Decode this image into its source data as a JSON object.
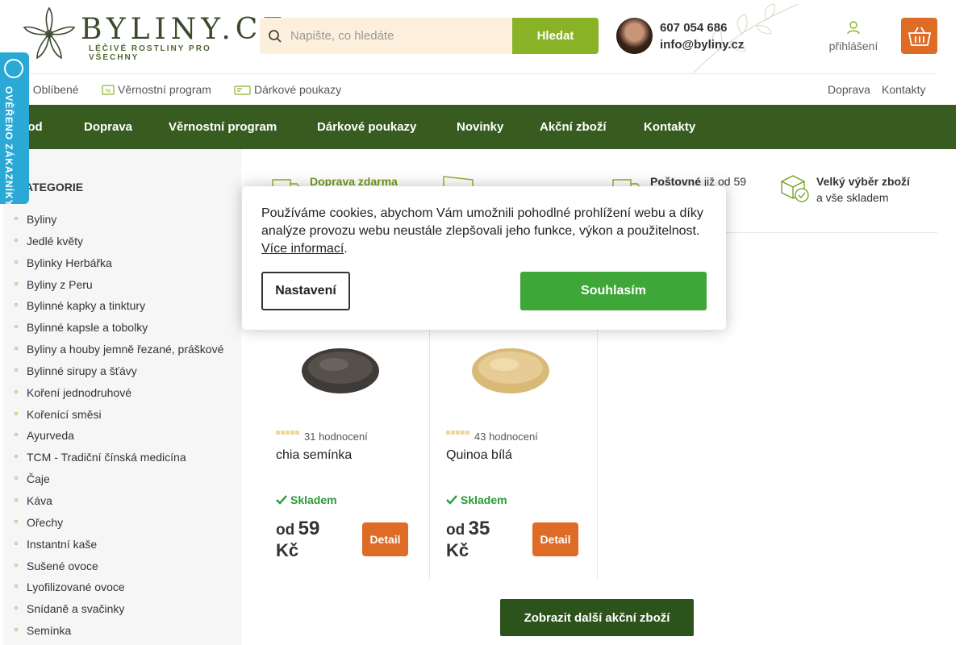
{
  "header": {
    "logo_text": "BYLINY.CZ",
    "logo_subtitle": "LÉČIVÉ ROSTLINY PRO VŠECHNY",
    "search_placeholder": "Napište, co hledáte",
    "search_button": "Hledat",
    "phone": "607 054 686",
    "email": "info@byliny.cz",
    "login_label": "přihlášení"
  },
  "subnav": {
    "left": [
      {
        "label": "Oblíbené",
        "icon": "heart-icon"
      },
      {
        "label": "Věrnostní program",
        "icon": "loyalty-card-icon"
      },
      {
        "label": "Dárkové poukazy",
        "icon": "gift-voucher-icon"
      }
    ],
    "right": [
      "Doprava",
      "Kontakty"
    ]
  },
  "mainnav": [
    "vod",
    "Doprava",
    "Věrnostní program",
    "Dárkové poukazy",
    "Novinky",
    "Akční zboží",
    "Kontakty"
  ],
  "verified_badge": "OVĚŘENO ZÁKAZNÍKY",
  "sidebar": {
    "title": "ATEGORIE",
    "items": [
      "Byliny",
      "Jedlé květy",
      "Bylinky Herbářka",
      "Byliny z Peru",
      "Bylinné kapky a tinktury",
      "Bylinné kapsle a tobolky",
      "Byliny a houby jemně řezané, práškové",
      "Bylinné sirupy a šťávy",
      "Koření jednodruhové",
      "Kořenící směsi",
      "Ayurveda",
      "TCM - Tradiční čínská medicína",
      "Čaje",
      "Káva",
      "Ořechy",
      "Instantní kaše",
      "Sušené ovoce",
      "Lyofilizované ovoce",
      "Snídaně a svačinky",
      "Semínka"
    ]
  },
  "benefits": [
    {
      "title": "Doprava zdarma",
      "text": ""
    },
    {
      "title": "",
      "text": ""
    },
    {
      "title": "Poštovné",
      "text": "již od 59"
    },
    {
      "title": "Velký výběr zboží",
      "text": "a vše skladem"
    }
  ],
  "products": [
    {
      "rating_count": "31 hodnocení",
      "name": "chia semínka",
      "stock": "Skladem",
      "price_prefix": "od",
      "price": "59",
      "currency": "Kč",
      "detail": "Detail"
    },
    {
      "rating_count": "43 hodnocení",
      "name": "Quinoa bílá",
      "stock": "Skladem",
      "price_prefix": "od",
      "price": "35",
      "currency": "Kč",
      "detail": "Detail"
    }
  ],
  "more_button": "Zobrazit další akční zboží",
  "cookie": {
    "text": "Používáme cookies, abychom Vám umožnili pohodlné prohlížení webu a díky analýze provozu webu neustále zlepšovali jeho funkce, výkon a použitelnost.",
    "link": "Více informací",
    "settings": "Nastavení",
    "accept": "Souhlasím"
  },
  "colors": {
    "brand_green": "#385c1f",
    "accent_orange": "#de6b26",
    "search_green": "#8ab227",
    "accept_green": "#3fa638",
    "stock_green": "#2a9a3a",
    "badge_blue": "#2aa9d6"
  }
}
